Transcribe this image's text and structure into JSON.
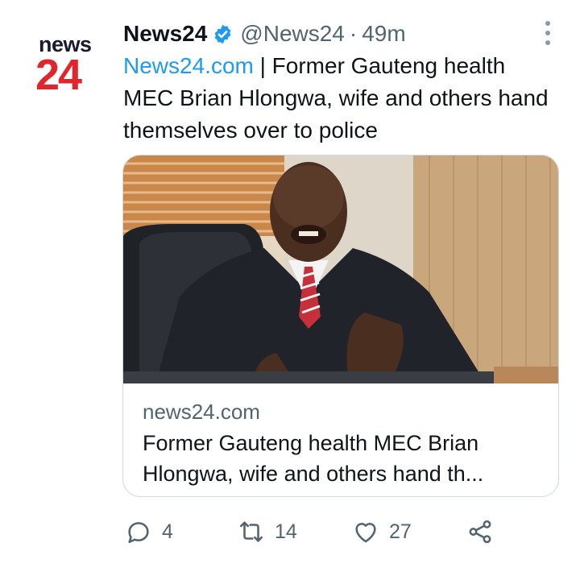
{
  "avatar": {
    "line1": "news",
    "line2": "24"
  },
  "author": {
    "name": "News24",
    "handle": "@News24",
    "separator": "·",
    "time": "49m"
  },
  "tweet": {
    "link_text": "News24.com",
    "text": " | Former Gauteng health MEC Brian Hlongwa, wife and others hand themselves over to police"
  },
  "card": {
    "domain": "news24.com",
    "title": "Former Gauteng health MEC Brian Hlongwa, wife and others hand th..."
  },
  "actions": {
    "reply_count": "4",
    "retweet_count": "14",
    "like_count": "27"
  },
  "icons": {
    "verified": "verified-badge-icon",
    "more": "more-options-icon",
    "reply": "reply-icon",
    "retweet": "retweet-icon",
    "like": "heart-icon",
    "share": "share-icon"
  },
  "colors": {
    "accent": "#1d9bf0",
    "secondary_text": "#536471",
    "brand_red": "#e0262d"
  }
}
